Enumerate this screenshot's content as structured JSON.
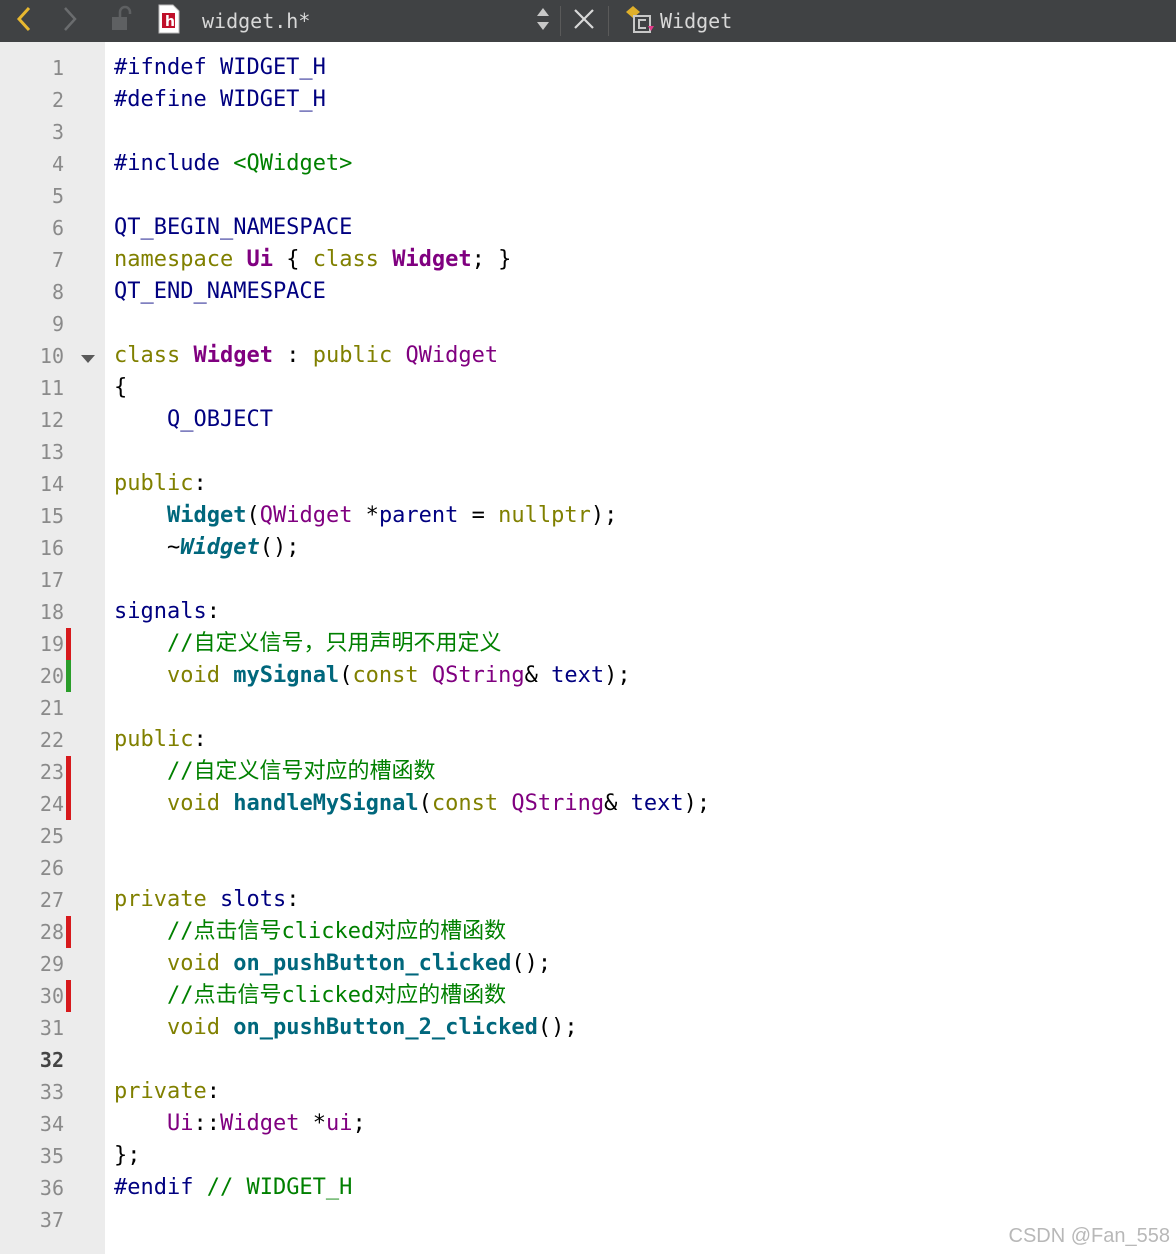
{
  "toolbar": {
    "file_name": "widget.h*",
    "class_name": "Widget",
    "file_icon_letter": "h",
    "icons": [
      "back-arrow-icon",
      "forward-arrow-icon",
      "unlock-icon",
      "header-file-icon",
      "updown-switch-icon",
      "close-icon",
      "class-icon"
    ]
  },
  "editor": {
    "current_line": 32,
    "lines": [
      {
        "n": "1",
        "tokens": [
          {
            "t": "#ifndef WIDGET_H",
            "c": "mac"
          }
        ]
      },
      {
        "n": "2",
        "tokens": [
          {
            "t": "#define WIDGET_H",
            "c": "mac"
          }
        ]
      },
      {
        "n": "3",
        "tokens": []
      },
      {
        "n": "4",
        "tokens": [
          {
            "t": "#include ",
            "c": "mac"
          },
          {
            "t": "<QWidget>",
            "c": "str"
          }
        ]
      },
      {
        "n": "5",
        "tokens": []
      },
      {
        "n": "6",
        "tokens": [
          {
            "t": "QT_BEGIN_NAMESPACE",
            "c": "mac"
          }
        ]
      },
      {
        "n": "7",
        "tokens": [
          {
            "t": "namespace ",
            "c": "kw"
          },
          {
            "t": "Ui",
            "c": "tyb"
          },
          {
            "t": " { ",
            "c": "pl"
          },
          {
            "t": "class ",
            "c": "kw"
          },
          {
            "t": "Widget",
            "c": "tyb"
          },
          {
            "t": "; }",
            "c": "pl"
          }
        ]
      },
      {
        "n": "8",
        "tokens": [
          {
            "t": "QT_END_NAMESPACE",
            "c": "mac"
          }
        ]
      },
      {
        "n": "9",
        "tokens": []
      },
      {
        "n": "10",
        "tokens": [
          {
            "t": "class ",
            "c": "kw"
          },
          {
            "t": "Widget",
            "c": "tyb"
          },
          {
            "t": " : ",
            "c": "pl"
          },
          {
            "t": "public ",
            "c": "kw"
          },
          {
            "t": "QWidget",
            "c": "ty"
          }
        ]
      },
      {
        "n": "11",
        "tokens": [
          {
            "t": "{",
            "c": "pl"
          }
        ]
      },
      {
        "n": "12",
        "tokens": [
          {
            "t": "    Q_OBJECT",
            "c": "mac"
          }
        ]
      },
      {
        "n": "13",
        "tokens": []
      },
      {
        "n": "14",
        "tokens": [
          {
            "t": "public",
            "c": "kw"
          },
          {
            "t": ":",
            "c": "pl"
          }
        ]
      },
      {
        "n": "15",
        "tokens": [
          {
            "t": "    ",
            "c": "pl"
          },
          {
            "t": "Widget",
            "c": "fn"
          },
          {
            "t": "(",
            "c": "pl"
          },
          {
            "t": "QWidget",
            "c": "ty"
          },
          {
            "t": " *",
            "c": "pl"
          },
          {
            "t": "parent",
            "c": "nm"
          },
          {
            "t": " = ",
            "c": "pl"
          },
          {
            "t": "nullptr",
            "c": "kw"
          },
          {
            "t": ");",
            "c": "pl"
          }
        ]
      },
      {
        "n": "16",
        "tokens": [
          {
            "t": "    ~",
            "c": "pl"
          },
          {
            "t": "Widget",
            "c": "fni"
          },
          {
            "t": "();",
            "c": "pl"
          }
        ]
      },
      {
        "n": "17",
        "tokens": []
      },
      {
        "n": "18",
        "tokens": [
          {
            "t": "signals",
            "c": "nm"
          },
          {
            "t": ":",
            "c": "pl"
          }
        ]
      },
      {
        "n": "19",
        "tokens": [
          {
            "t": "    //自定义信号，只用声明不用定义",
            "c": "cm"
          }
        ]
      },
      {
        "n": "20",
        "tokens": [
          {
            "t": "    ",
            "c": "pl"
          },
          {
            "t": "void ",
            "c": "kw"
          },
          {
            "t": "mySignal",
            "c": "fn"
          },
          {
            "t": "(",
            "c": "pl"
          },
          {
            "t": "const ",
            "c": "kw"
          },
          {
            "t": "QString",
            "c": "ty"
          },
          {
            "t": "& ",
            "c": "pl"
          },
          {
            "t": "text",
            "c": "nm"
          },
          {
            "t": ");",
            "c": "pl"
          }
        ]
      },
      {
        "n": "21",
        "tokens": []
      },
      {
        "n": "22",
        "tokens": [
          {
            "t": "public",
            "c": "kw"
          },
          {
            "t": ":",
            "c": "pl"
          }
        ]
      },
      {
        "n": "23",
        "tokens": [
          {
            "t": "    //自定义信号对应的槽函数",
            "c": "cm"
          }
        ]
      },
      {
        "n": "24",
        "tokens": [
          {
            "t": "    ",
            "c": "pl"
          },
          {
            "t": "void ",
            "c": "kw"
          },
          {
            "t": "handleMySignal",
            "c": "fn"
          },
          {
            "t": "(",
            "c": "pl"
          },
          {
            "t": "const ",
            "c": "kw"
          },
          {
            "t": "QString",
            "c": "ty"
          },
          {
            "t": "& ",
            "c": "pl"
          },
          {
            "t": "text",
            "c": "nm"
          },
          {
            "t": ");",
            "c": "pl"
          }
        ]
      },
      {
        "n": "25",
        "tokens": []
      },
      {
        "n": "26",
        "tokens": []
      },
      {
        "n": "27",
        "tokens": [
          {
            "t": "private ",
            "c": "kw"
          },
          {
            "t": "slots",
            "c": "nm"
          },
          {
            "t": ":",
            "c": "pl"
          }
        ]
      },
      {
        "n": "28",
        "tokens": [
          {
            "t": "    //点击信号clicked对应的槽函数",
            "c": "cm"
          }
        ]
      },
      {
        "n": "29",
        "tokens": [
          {
            "t": "    ",
            "c": "pl"
          },
          {
            "t": "void ",
            "c": "kw"
          },
          {
            "t": "on_pushButton_clicked",
            "c": "fn"
          },
          {
            "t": "();",
            "c": "pl"
          }
        ]
      },
      {
        "n": "30",
        "tokens": [
          {
            "t": "    //点击信号clicked对应的槽函数",
            "c": "cm"
          }
        ]
      },
      {
        "n": "31",
        "tokens": [
          {
            "t": "    ",
            "c": "pl"
          },
          {
            "t": "void ",
            "c": "kw"
          },
          {
            "t": "on_pushButton_2_clicked",
            "c": "fn"
          },
          {
            "t": "();",
            "c": "pl"
          }
        ]
      },
      {
        "n": "32",
        "tokens": []
      },
      {
        "n": "33",
        "tokens": [
          {
            "t": "private",
            "c": "kw"
          },
          {
            "t": ":",
            "c": "pl"
          }
        ]
      },
      {
        "n": "34",
        "tokens": [
          {
            "t": "    ",
            "c": "pl"
          },
          {
            "t": "Ui",
            "c": "ty"
          },
          {
            "t": "::",
            "c": "pl"
          },
          {
            "t": "Widget",
            "c": "ty"
          },
          {
            "t": " *",
            "c": "pl"
          },
          {
            "t": "ui",
            "c": "ty"
          },
          {
            "t": ";",
            "c": "pl"
          }
        ]
      },
      {
        "n": "35",
        "tokens": [
          {
            "t": "};",
            "c": "pl"
          }
        ]
      },
      {
        "n": "36",
        "tokens": [
          {
            "t": "#endif ",
            "c": "mac"
          },
          {
            "t": "// WIDGET_H",
            "c": "cm"
          }
        ]
      },
      {
        "n": "37",
        "tokens": []
      }
    ],
    "change_markers": [
      {
        "line": 19,
        "color": "#d7191c"
      },
      {
        "line": 20,
        "color": "#2a9d2a"
      },
      {
        "line": 23,
        "color": "#d7191c"
      },
      {
        "line": 24,
        "color": "#d7191c"
      },
      {
        "line": 28,
        "color": "#d7191c"
      },
      {
        "line": 30,
        "color": "#d7191c"
      }
    ],
    "fold_line": 10
  },
  "colors": {
    "toolbar_bg": "#404244",
    "gutter_bg": "#ececec",
    "keyword": "#808000",
    "type": "#800080",
    "function": "#00677c",
    "string_comment": "#008000",
    "macro": "#000080"
  },
  "watermark": "CSDN @Fan_558"
}
